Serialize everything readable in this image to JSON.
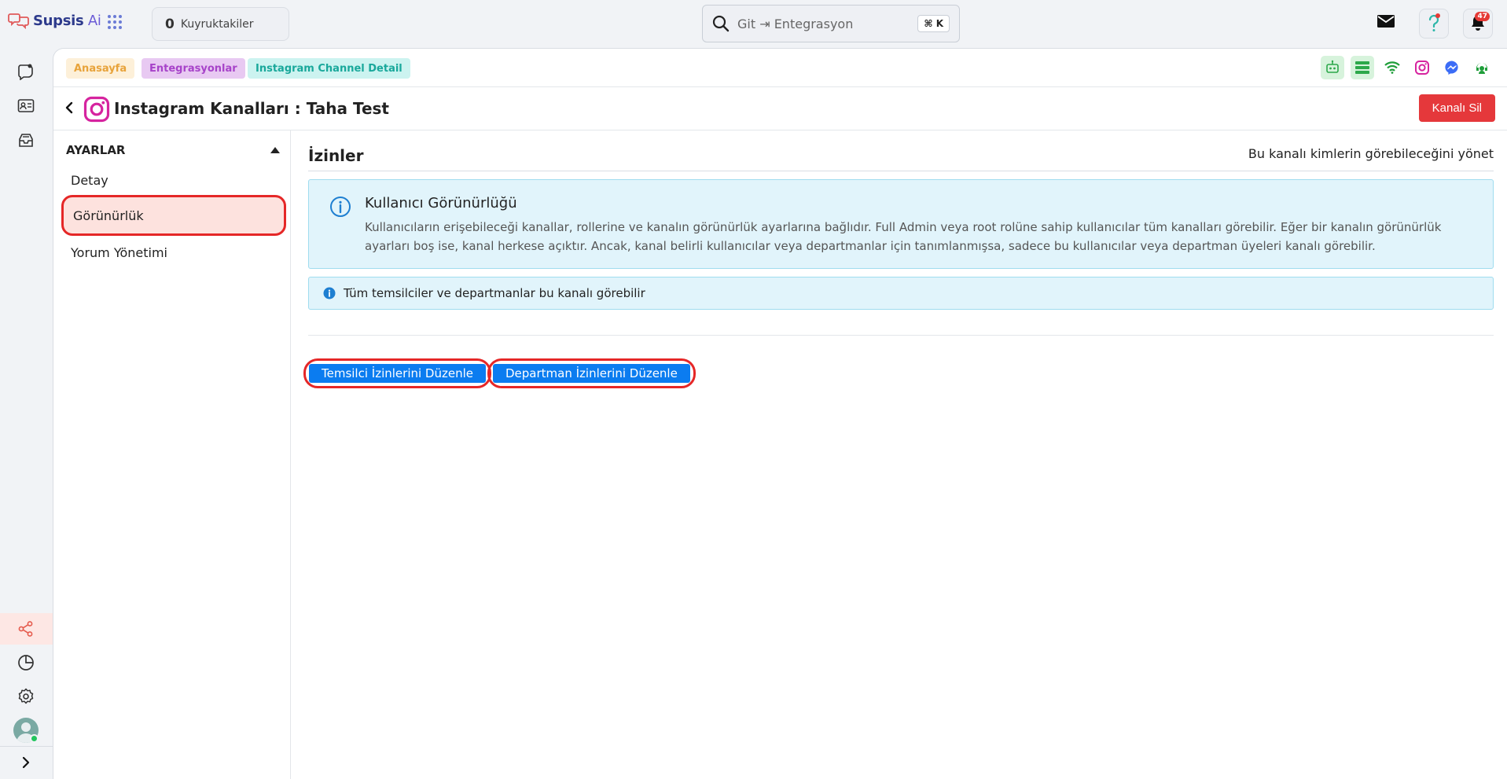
{
  "app": {
    "name": "Supsis",
    "name_suffix": " Ai"
  },
  "topbar": {
    "queue_count": "0",
    "queue_label": "Kuyruktakiler",
    "search_placeholder": "Git ⇥ Entegrasyon",
    "search_shortcut": "⌘ K",
    "notification_count": "47"
  },
  "breadcrumbs": [
    "Anasayfa",
    "Entegrasyonlar",
    "Instagram Channel Detail"
  ],
  "header": {
    "title": "Instagram Kanalları : Taha Test",
    "delete_label": "Kanalı Sil"
  },
  "settings": {
    "title": "AYARLAR",
    "items": [
      {
        "label": "Detay",
        "active": false
      },
      {
        "label": "Görünürlük",
        "active": true
      },
      {
        "label": "Yorum Yönetimi",
        "active": false
      }
    ]
  },
  "section": {
    "title": "İzinler",
    "description": "Bu kanalı kimlerin görebileceğini yönet"
  },
  "info": {
    "title": "Kullanıcı Görünürlüğü",
    "text": "Kullanıcıların erişebileceği kanallar, rollerine ve kanalın görünürlük ayarlarına bağlıdır. Full Admin veya root rolüne sahip kullanıcılar tüm kanalları görebilir. Eğer bir kanalın görünürlük ayarları boş ise, kanal herkese açıktır. Ancak, kanal belirli kullanıcılar veya departmanlar için tanımlanmışsa, sadece bu kullanıcılar veya departman üyeleri kanalı görebilir."
  },
  "note": {
    "text": "Tüm temsilciler ve departmanlar bu kanalı görebilir"
  },
  "actions": {
    "agent_permissions_label": "Temsilci İzinlerini Düzenle",
    "department_permissions_label": "Departman İzinlerini Düzenle"
  },
  "colors": {
    "accent": "#0b7cf0",
    "danger": "#e5383b",
    "info_bg": "#e1f4fb",
    "highlight": "#e52727"
  }
}
